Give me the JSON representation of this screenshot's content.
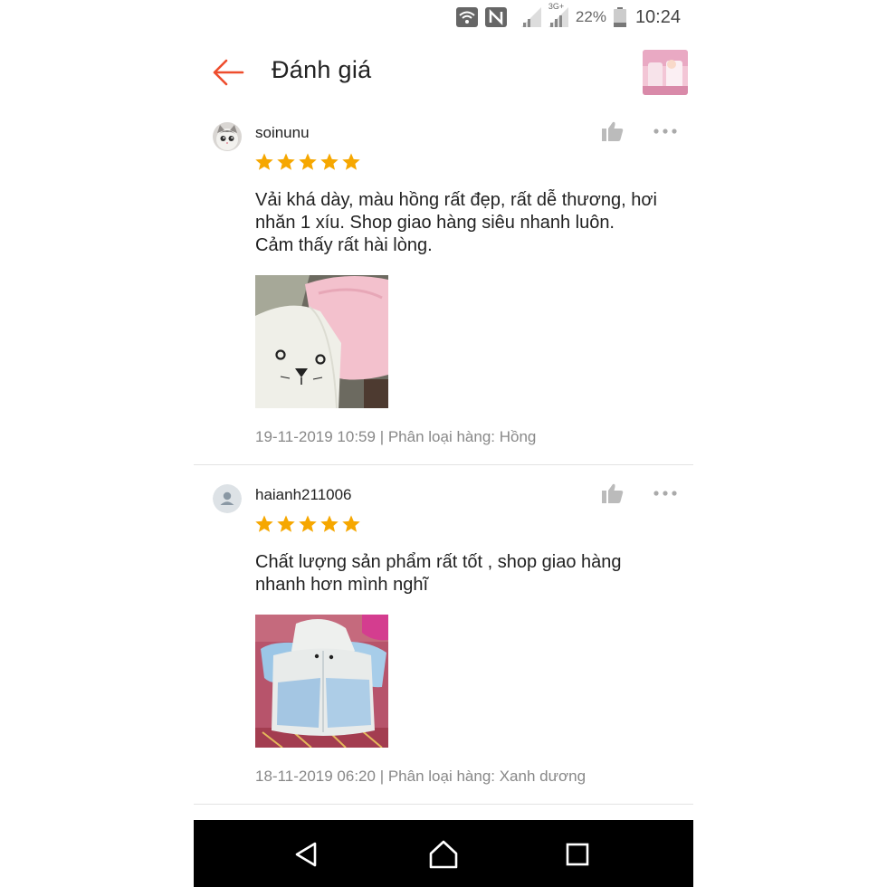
{
  "status_bar": {
    "battery_percent": "22%",
    "time": "10:24",
    "network_label": "3G+",
    "icons": [
      "wifi-icon",
      "nfc-icon",
      "signal-icon",
      "signal-3g-icon",
      "battery-icon"
    ]
  },
  "header": {
    "title": "Đánh giá",
    "back_icon": "arrow-left-icon",
    "accent_color": "#ee4d2d"
  },
  "reviews": [
    {
      "username": "soinunu",
      "avatar": "cat-avatar",
      "rating": 5,
      "comment": "Vải khá dày, màu hồng rất đẹp, rất dễ thương, hơi\nnhăn 1 xíu. Shop giao hàng siêu nhanh luôn.\nCảm thấy rất hài lòng.",
      "image": "pink-white-hoodie-photo",
      "date": "19-11-2019 10:59",
      "variation": "| Phân loại hàng: Hồng"
    },
    {
      "username": "haianh211006",
      "avatar": "default-user-avatar",
      "rating": 5,
      "comment": "Chất lượng sản phẩm rất tốt , shop giao hàng\nnhanh hơn mình nghĩ",
      "image": "blue-white-hoodie-photo",
      "date": "18-11-2019 06:20",
      "variation": "| Phân loại hàng: Xanh dương"
    }
  ],
  "star_color": "#f6a700",
  "navbar": {
    "buttons": [
      "back-triangle-icon",
      "home-icon",
      "recents-square-icon"
    ]
  }
}
